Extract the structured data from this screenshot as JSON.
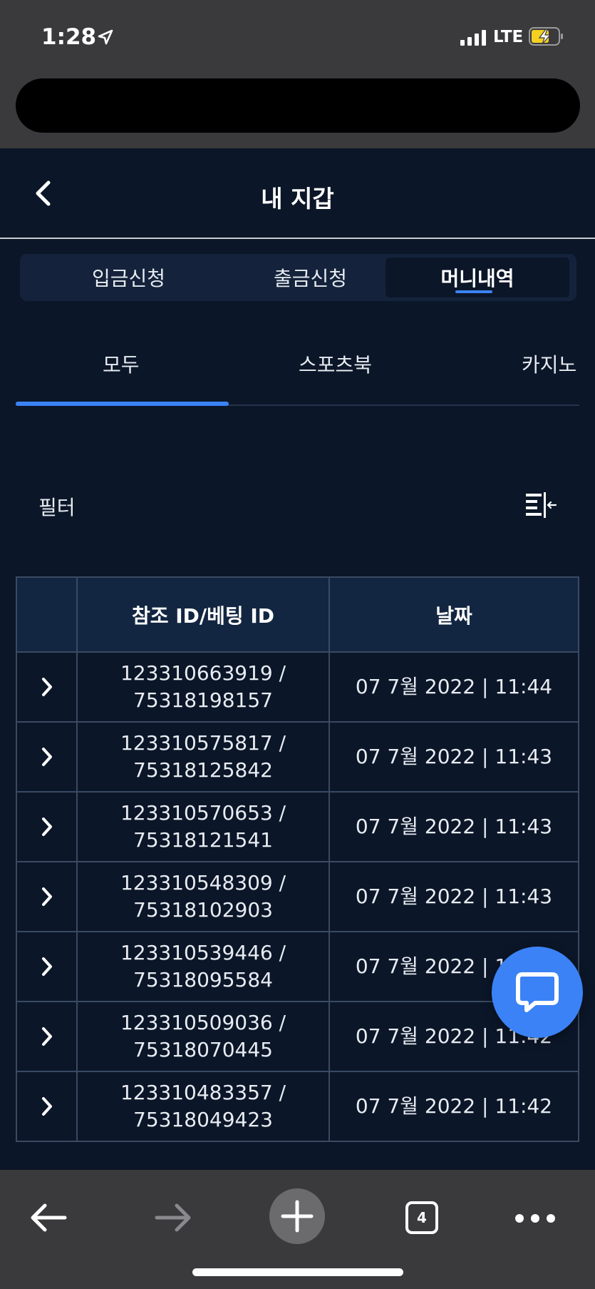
{
  "status_bar": {
    "time": "1:28",
    "network": "LTE"
  },
  "header": {
    "title": "내 지갑"
  },
  "segments": [
    {
      "label": "입금신청",
      "active": false
    },
    {
      "label": "출금신청",
      "active": false
    },
    {
      "label": "머니내역",
      "active": true
    }
  ],
  "subtabs": [
    {
      "label": "모두",
      "active": true
    },
    {
      "label": "스포츠북",
      "active": false
    },
    {
      "label": "카지노",
      "active": false
    }
  ],
  "filter": {
    "label": "필터"
  },
  "table": {
    "columns": [
      "",
      "참조 ID/베팅 ID",
      "날짜"
    ],
    "rows": [
      {
        "ref_id": "123310663919 /",
        "bet_id": "75318198157",
        "date": "07 7월 2022 | 11:44"
      },
      {
        "ref_id": "123310575817 /",
        "bet_id": "75318125842",
        "date": "07 7월 2022 | 11:43"
      },
      {
        "ref_id": "123310570653 /",
        "bet_id": "75318121541",
        "date": "07 7월 2022 | 11:43"
      },
      {
        "ref_id": "123310548309 /",
        "bet_id": "75318102903",
        "date": "07 7월 2022 | 11:43"
      },
      {
        "ref_id": "123310539446 /",
        "bet_id": "75318095584",
        "date": "07 7월 2022 | 11:43"
      },
      {
        "ref_id": "123310509036 /",
        "bet_id": "75318070445",
        "date": "07 7월 2022 | 11:42"
      },
      {
        "ref_id": "123310483357 /",
        "bet_id": "75318049423",
        "date": "07 7월 2022 | 11:42"
      }
    ]
  },
  "browser": {
    "tab_count": "4"
  },
  "colors": {
    "background": "#0b1628",
    "accent": "#3b82f6",
    "table_header": "#132641",
    "chrome": "#3a3a3c"
  },
  "icons": {
    "back": "chevron-left-icon",
    "filter": "filter-sort-icon",
    "row_expand": "chevron-right-icon",
    "chat": "chat-bubble-icon"
  }
}
